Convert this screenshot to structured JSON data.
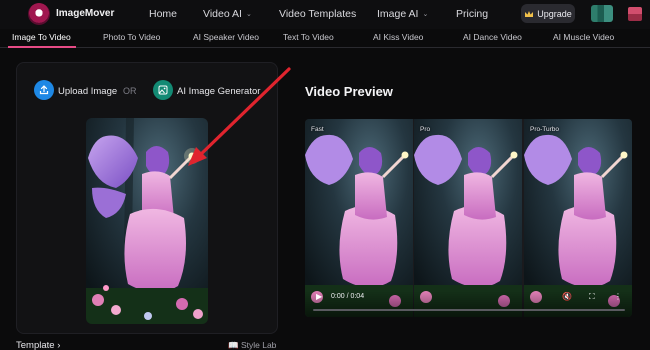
{
  "app": {
    "name": "ImageMover"
  },
  "nav": {
    "items": [
      {
        "label": "Home",
        "dropdown": false
      },
      {
        "label": "Video AI",
        "dropdown": true
      },
      {
        "label": "Video Templates",
        "dropdown": false
      },
      {
        "label": "Image AI",
        "dropdown": true
      },
      {
        "label": "Pricing",
        "dropdown": false
      }
    ],
    "upgrade_label": "Upgrade"
  },
  "tabs": [
    {
      "label": "Image To Video",
      "active": true
    },
    {
      "label": "Photo To Video",
      "active": false
    },
    {
      "label": "AI Speaker Video",
      "active": false
    },
    {
      "label": "Text To Video",
      "active": false
    },
    {
      "label": "AI Kiss Video",
      "active": false
    },
    {
      "label": "AI Dance Video",
      "active": false
    },
    {
      "label": "AI Muscle Video",
      "active": false
    }
  ],
  "left": {
    "upload_label": "Upload Image",
    "or_label": "OR",
    "generator_label": "AI Image Generator",
    "template_label": "Template",
    "stylelab_label": "Style Lab"
  },
  "right": {
    "title": "Video Preview",
    "clips": [
      "Fast",
      "Pro",
      "Pro-Turbo"
    ],
    "time": "0:00 / 0:04"
  },
  "colors": {
    "accent": "#e64b86",
    "upload": "#1e88e5",
    "generator": "#138a74",
    "arrow": "#e0242e"
  }
}
